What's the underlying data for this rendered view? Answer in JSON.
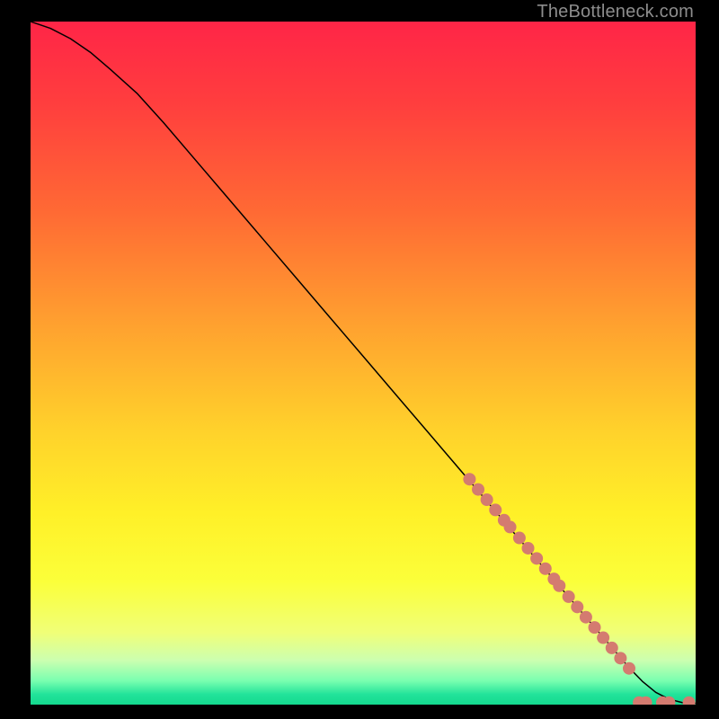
{
  "watermark": "TheBottleneck.com",
  "chart_data": {
    "type": "line",
    "title": "",
    "xlabel": "",
    "ylabel": "",
    "xlim": [
      0,
      100
    ],
    "ylim": [
      0,
      100
    ],
    "background_gradient": {
      "stops": [
        {
          "offset": 0.0,
          "color": "#ff2547"
        },
        {
          "offset": 0.12,
          "color": "#ff3e3e"
        },
        {
          "offset": 0.28,
          "color": "#ff6a34"
        },
        {
          "offset": 0.45,
          "color": "#ffa32f"
        },
        {
          "offset": 0.6,
          "color": "#ffd22b"
        },
        {
          "offset": 0.72,
          "color": "#fff028"
        },
        {
          "offset": 0.82,
          "color": "#fbff3a"
        },
        {
          "offset": 0.895,
          "color": "#f0ff78"
        },
        {
          "offset": 0.935,
          "color": "#ccffb0"
        },
        {
          "offset": 0.965,
          "color": "#7affb0"
        },
        {
          "offset": 0.985,
          "color": "#22e39a"
        },
        {
          "offset": 1.0,
          "color": "#14d98f"
        }
      ]
    },
    "series": [
      {
        "name": "curve",
        "stroke": "#000000",
        "stroke_width": 1.5,
        "x": [
          0,
          3,
          6,
          9,
          12,
          16,
          20,
          25,
          30,
          35,
          40,
          45,
          50,
          55,
          60,
          65,
          70,
          75,
          80,
          85,
          88,
          90,
          92,
          94,
          96,
          98,
          100
        ],
        "y": [
          100,
          99,
          97.5,
          95.5,
          93,
          89.5,
          85.2,
          79.5,
          73.8,
          68.1,
          62.4,
          56.7,
          51.0,
          45.3,
          39.6,
          33.9,
          28.2,
          22.5,
          16.8,
          11.1,
          7.7,
          5.4,
          3.4,
          1.8,
          0.8,
          0.3,
          0.2
        ]
      }
    ],
    "marker_cluster": {
      "color": "#d47b70",
      "radius": 7,
      "points": [
        {
          "x": 66.0,
          "y": 33.0
        },
        {
          "x": 67.3,
          "y": 31.5
        },
        {
          "x": 68.6,
          "y": 30.0
        },
        {
          "x": 69.9,
          "y": 28.5
        },
        {
          "x": 71.2,
          "y": 27.0
        },
        {
          "x": 72.1,
          "y": 26.0
        },
        {
          "x": 73.5,
          "y": 24.4
        },
        {
          "x": 74.8,
          "y": 22.9
        },
        {
          "x": 76.1,
          "y": 21.4
        },
        {
          "x": 77.4,
          "y": 19.9
        },
        {
          "x": 78.7,
          "y": 18.4
        },
        {
          "x": 79.5,
          "y": 17.4
        },
        {
          "x": 80.9,
          "y": 15.8
        },
        {
          "x": 82.2,
          "y": 14.3
        },
        {
          "x": 83.5,
          "y": 12.8
        },
        {
          "x": 84.8,
          "y": 11.3
        },
        {
          "x": 86.1,
          "y": 9.8
        },
        {
          "x": 87.4,
          "y": 8.3
        },
        {
          "x": 88.7,
          "y": 6.8
        },
        {
          "x": 90.0,
          "y": 5.3
        },
        {
          "x": 91.5,
          "y": 0.3
        },
        {
          "x": 92.5,
          "y": 0.3
        },
        {
          "x": 95.0,
          "y": 0.3
        },
        {
          "x": 96.0,
          "y": 0.3
        },
        {
          "x": 99.0,
          "y": 0.3
        }
      ]
    }
  }
}
